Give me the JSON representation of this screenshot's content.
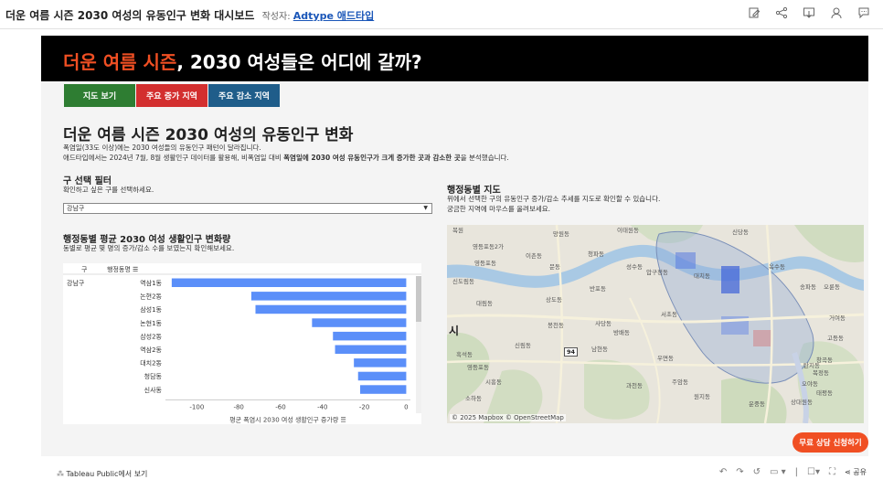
{
  "header": {
    "title": "더운 여름 시즌 2030 여성의 유동인구 변화 대시보드",
    "author_prefix": "작성자:",
    "author_name": "Adtype 애드타입"
  },
  "banner": {
    "highlight": "더운 여름 시즌",
    "rest": ", 2030 여성들은 어디에 갈까?"
  },
  "tabs": [
    {
      "label": "지도 보기",
      "color": "#2e7d32"
    },
    {
      "label": "주요 증가 지역",
      "color": "#d32f2f"
    },
    {
      "label": "주요 감소 지역",
      "color": "#1f5d8a"
    }
  ],
  "main": {
    "title": "더운 여름 시즌 2030 여성의 유동인구 변화",
    "desc1": "폭염일(33도 이상)에는 2030 여성들의 유동인구 패턴이 달라집니다.",
    "desc2_a": "애드타입에서는 2024년 7월, 8월 생활인구 데이터를 활용해, 비폭염일 대비 ",
    "desc2_b": "폭염일에 2030 여성 유동인구가 크게 증가한 곳과 감소한 곳",
    "desc2_c": "을 분석했습니다."
  },
  "filter": {
    "title": "구 선택 필터",
    "sub": "확인하고 싶은 구를 선택하세요.",
    "value": "강남구"
  },
  "chart_section": {
    "title": "행정동별 평균 2030 여성 생활인구 변화량",
    "sub": "동별로 평균 몇 명의 증가/감소 수를 보였는지 확인해보세요."
  },
  "map_section": {
    "title": "행정동별 지도",
    "sub1": "위에서 선택한 구의 유동인구 증가/감소 추세를 지도로 확인할 수 있습니다.",
    "sub2": "궁금한 지역에 마우스를 올려보세요.",
    "attribution": "© 2025 Mapbox  © OpenStreetMap",
    "labels": [
      "복원",
      "영등포동2가",
      "망원동",
      "이태원동",
      "신당동",
      "영등포동",
      "문동",
      "이촌동",
      "청파동",
      "성수동",
      "옥수동",
      "신도림동",
      "대림동",
      "흑석동",
      "반포동",
      "압구정동",
      "송파동",
      "오륜동",
      "상도동",
      "사당동",
      "서초동",
      "봉천동",
      "방배동",
      "남현동",
      "대치동",
      "거여동",
      "신림동",
      "우면동",
      "영등포동",
      "시흥동",
      "과천동",
      "주암동",
      "원지동",
      "소하동",
      "탄지동",
      "복정동",
      "창곡동",
      "태평동",
      "상대원동",
      "오야동",
      "고등동",
      "운중동",
      "시",
      "94"
    ],
    "road_number": "94"
  },
  "chart_data": {
    "type": "bar",
    "orientation": "horizontal",
    "col_gu": "구",
    "col_dong": "행정동명",
    "gu": "강남구",
    "categories": [
      "역삼1동",
      "논현2동",
      "삼성1동",
      "논현1동",
      "삼성2동",
      "역삼2동",
      "대치2동",
      "청담동",
      "신사동"
    ],
    "values": [
      -112,
      -74,
      -72,
      -45,
      -35,
      -34,
      -25,
      -23,
      -22
    ],
    "xlim": [
      -115,
      2
    ],
    "xticks": [
      -100,
      -80,
      -60,
      -40,
      -20,
      0
    ],
    "xlabel": "평균 폭염시 2030 여성 생활인구 증가량",
    "bar_color": "#5b8ff9"
  },
  "cta": {
    "label": "무료 상담 신청하기",
    "color": "#f04f23"
  },
  "footer": {
    "tableau_label": "Tableau Public에서 보기",
    "share_label": "공유"
  }
}
